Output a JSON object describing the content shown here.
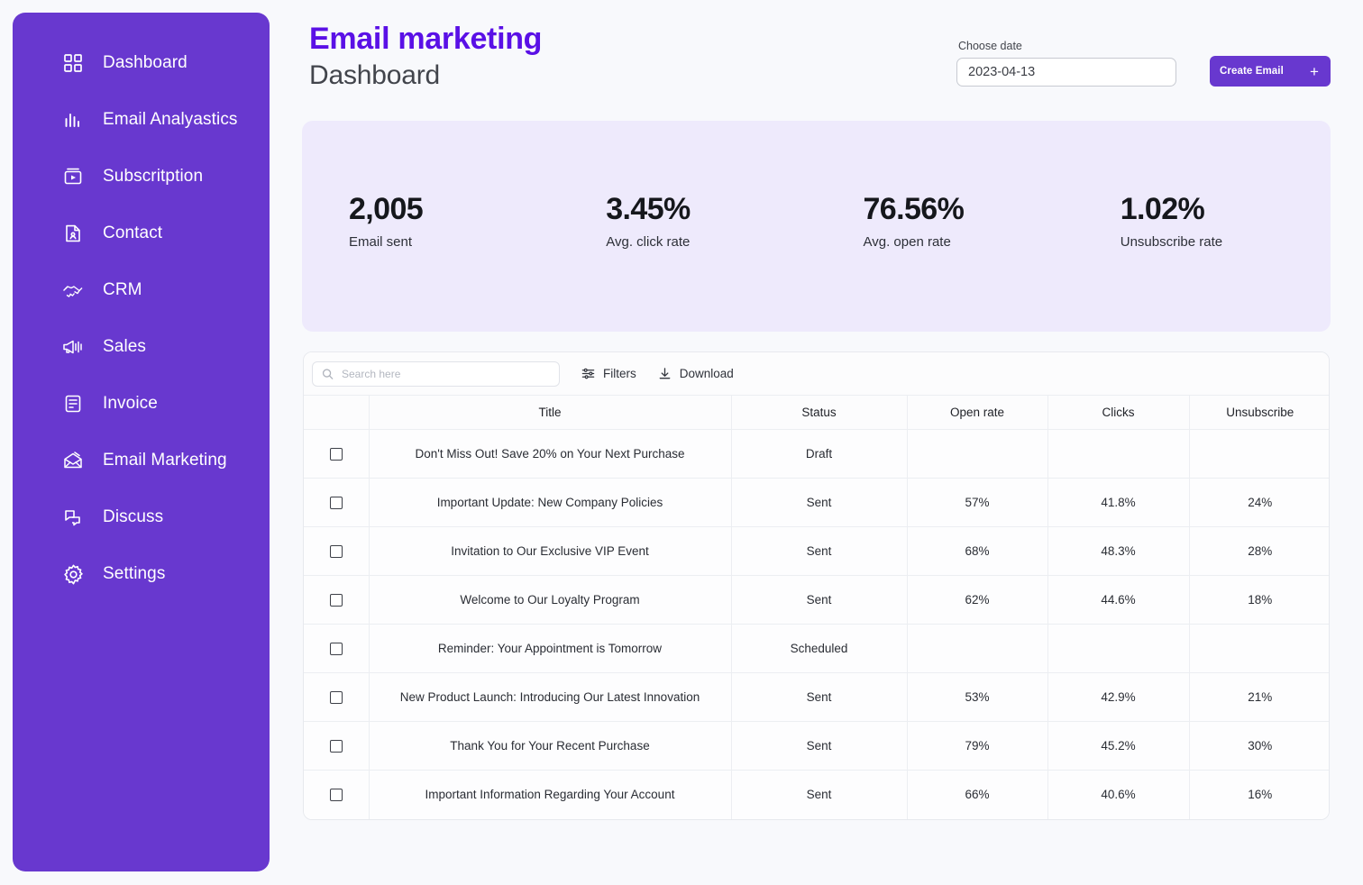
{
  "theme": {
    "brand_purple": "#6838cf",
    "title_purple": "#5a10e6",
    "stats_bg": "#eeeafc",
    "page_bg": "#f8f9fc"
  },
  "sidebar": {
    "items": [
      {
        "label": "Dashboard",
        "icon": "grid-icon"
      },
      {
        "label": "Email Analyastics",
        "icon": "bar-chart-icon"
      },
      {
        "label": "Subscritption",
        "icon": "video-window-icon"
      },
      {
        "label": "Contact",
        "icon": "contact-document-icon"
      },
      {
        "label": "CRM",
        "icon": "handshake-icon"
      },
      {
        "label": "Sales",
        "icon": "megaphone-icon"
      },
      {
        "label": "Invoice",
        "icon": "invoice-document-icon"
      },
      {
        "label": "Email Marketing",
        "icon": "open-envelope-icon"
      },
      {
        "label": "Discuss",
        "icon": "chat-bubbles-icon"
      },
      {
        "label": "Settings",
        "icon": "gear-icon"
      }
    ]
  },
  "header": {
    "title_main": "Email marketing",
    "title_sub": "Dashboard",
    "date_label": "Choose date",
    "date_value": "2023-04-13",
    "create_button": "Create Email",
    "create_button_icon": "plus-icon"
  },
  "stats": [
    {
      "value": "2,005",
      "label": "Email sent"
    },
    {
      "value": "3.45%",
      "label": "Avg. click rate"
    },
    {
      "value": "76.56%",
      "label": "Avg. open rate"
    },
    {
      "value": "1.02%",
      "label": "Unsubscribe rate"
    }
  ],
  "toolbar": {
    "search_placeholder": "Search here",
    "search_value": "",
    "filters_label": "Filters",
    "download_label": "Download"
  },
  "table": {
    "columns": [
      "",
      "Title",
      "Status",
      "Open rate",
      "Clicks",
      "Unsubscribe"
    ],
    "rows": [
      {
        "title": "Don't Miss Out! Save 20% on Your Next Purchase",
        "status": "Draft",
        "open_rate": "",
        "clicks": "",
        "unsubscribe": ""
      },
      {
        "title": "Important Update: New Company Policies",
        "status": "Sent",
        "open_rate": "57%",
        "clicks": "41.8%",
        "unsubscribe": "24%"
      },
      {
        "title": "Invitation to Our Exclusive VIP Event",
        "status": "Sent",
        "open_rate": "68%",
        "clicks": "48.3%",
        "unsubscribe": "28%"
      },
      {
        "title": "Welcome to Our Loyalty Program",
        "status": "Sent",
        "open_rate": "62%",
        "clicks": "44.6%",
        "unsubscribe": "18%"
      },
      {
        "title": "Reminder: Your Appointment is Tomorrow",
        "status": "Scheduled",
        "open_rate": "",
        "clicks": "",
        "unsubscribe": ""
      },
      {
        "title": "New Product Launch: Introducing Our Latest Innovation",
        "status": "Sent",
        "open_rate": "53%",
        "clicks": "42.9%",
        "unsubscribe": "21%"
      },
      {
        "title": "Thank You for Your Recent Purchase",
        "status": "Sent",
        "open_rate": "79%",
        "clicks": "45.2%",
        "unsubscribe": "30%"
      },
      {
        "title": "Important Information Regarding Your Account",
        "status": "Sent",
        "open_rate": "66%",
        "clicks": "40.6%",
        "unsubscribe": "16%"
      }
    ]
  }
}
